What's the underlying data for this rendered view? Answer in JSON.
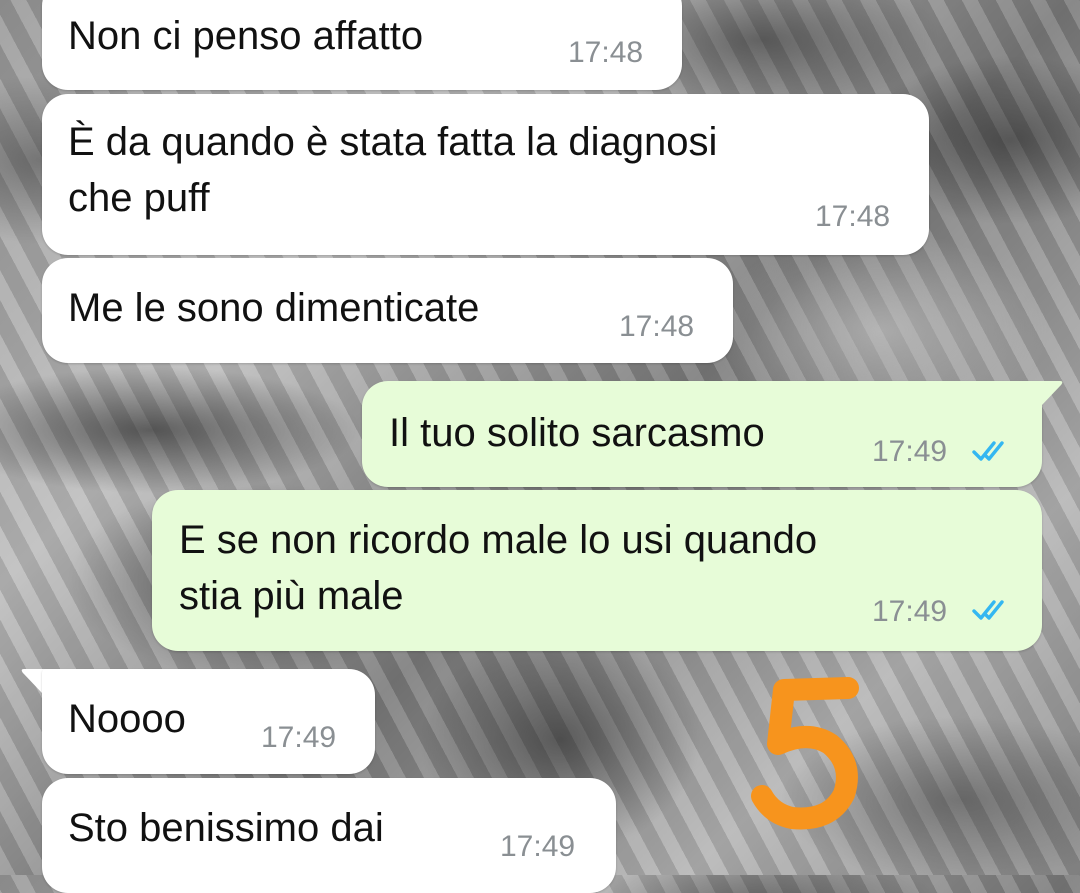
{
  "messages": [
    {
      "direction": "incoming",
      "text": "Non ci penso affatto",
      "time": "17:48"
    },
    {
      "direction": "incoming",
      "text": "È da quando è stata fatta la diagnosi\nche puff",
      "time": "17:48"
    },
    {
      "direction": "incoming",
      "text": "Me le sono dimenticate",
      "time": "17:48"
    },
    {
      "direction": "outgoing",
      "text": "Il tuo solito sarcasmo",
      "time": "17:49",
      "status": "read"
    },
    {
      "direction": "outgoing",
      "text": "E se non ricordo male lo usi quando\nstia più male",
      "time": "17:49",
      "status": "read"
    },
    {
      "direction": "incoming",
      "text": "Noooo",
      "time": "17:49"
    },
    {
      "direction": "incoming",
      "text": "Sto benissimo dai",
      "time": "17:49"
    }
  ],
  "annotation": {
    "text": "5",
    "color": "#f7941d"
  },
  "icons": {
    "read_receipt": "double-check-icon"
  },
  "colors": {
    "incoming_bubble": "#ffffff",
    "outgoing_bubble": "#e7fcd8",
    "timestamp": "#8a8f93",
    "read_tick": "#34b7f1"
  }
}
